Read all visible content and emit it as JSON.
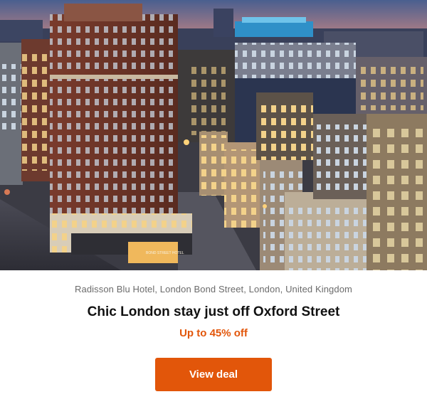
{
  "deal": {
    "location": "Radisson Blu Hotel, London Bond Street, London, United Kingdom",
    "title": "Chic London stay just off Oxford Street",
    "discount": "Up to 45% off",
    "cta_label": "View deal"
  },
  "hero_image": {
    "subject": "city-dusk-hotel-photo",
    "sign_text": "BOND STREET HOTEL"
  },
  "colors": {
    "accent": "#e2560a",
    "title": "#111111",
    "muted": "#6b6b6b"
  }
}
